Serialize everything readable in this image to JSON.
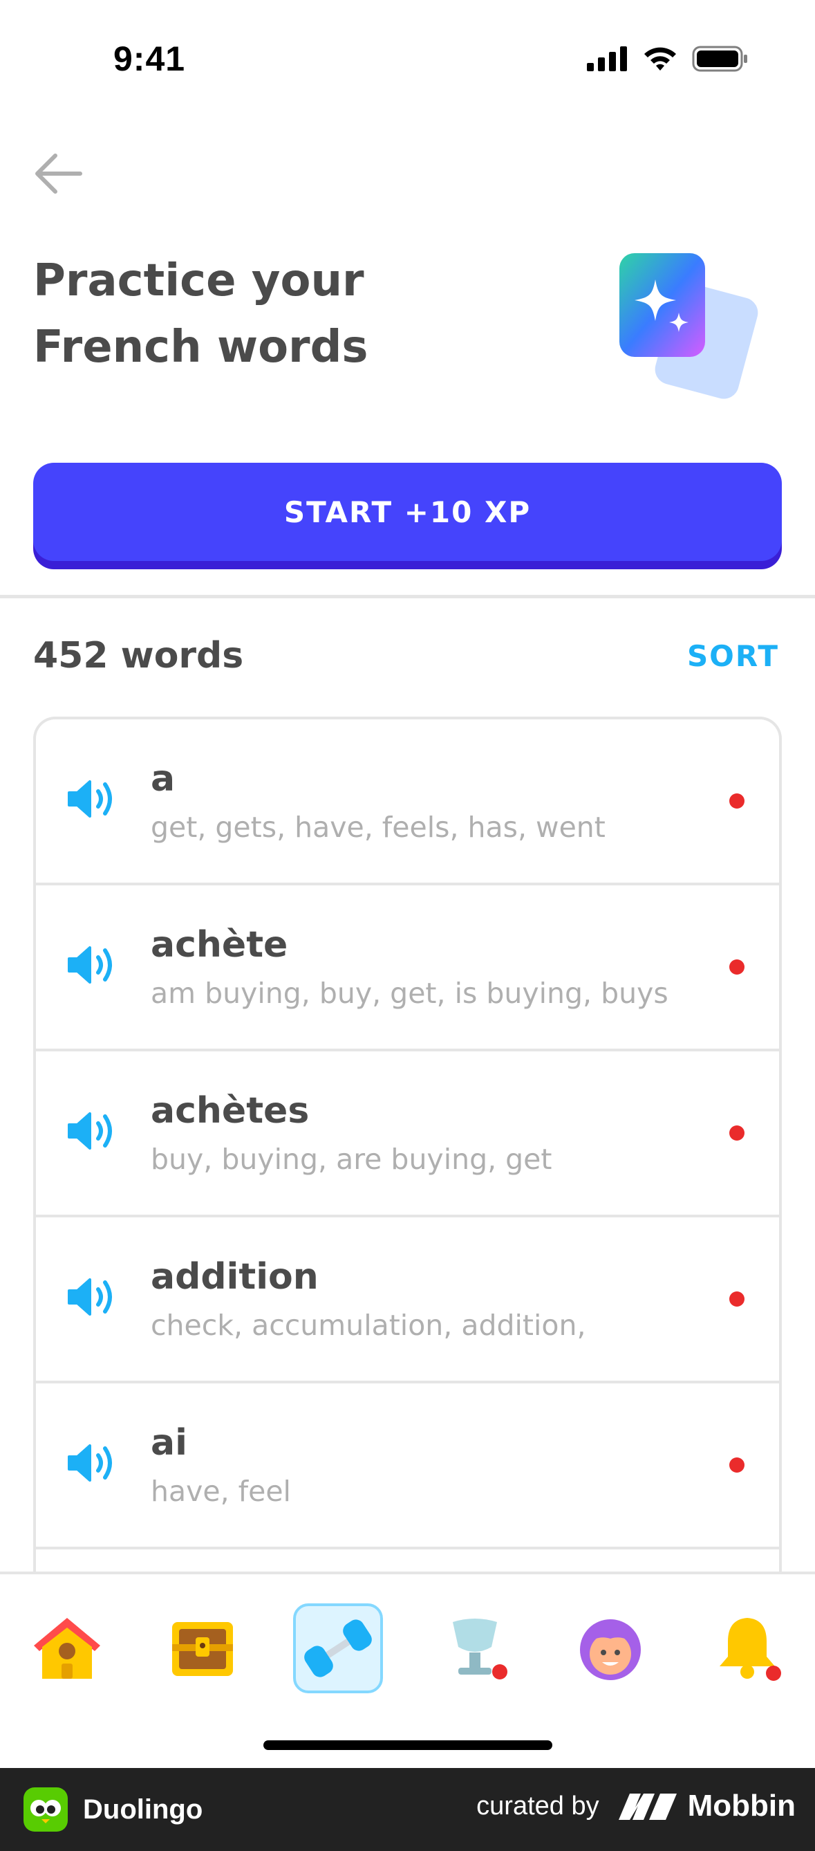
{
  "status_bar": {
    "time": "9:41"
  },
  "hero": {
    "title_line1": "Practice your",
    "title_line2": "French words"
  },
  "start_button": {
    "label": "START +10 XP"
  },
  "words": {
    "count_label": "452 words",
    "sort_label": "SORT",
    "items": [
      {
        "word": "a",
        "translations": "get, gets, have, feels, has, went"
      },
      {
        "word": "achète",
        "translations": "am buying, buy, get, is buying, buys"
      },
      {
        "word": "achètes",
        "translations": "buy, buying, are buying, get"
      },
      {
        "word": "addition",
        "translations": "check, accumulation, addition,"
      },
      {
        "word": "ai",
        "translations": "have, feel"
      }
    ]
  },
  "bottom_nav": {
    "items": [
      {
        "name": "home",
        "icon": "house-icon"
      },
      {
        "name": "chest",
        "icon": "treasure-chest-icon"
      },
      {
        "name": "practice",
        "icon": "dumbbell-icon",
        "active": true
      },
      {
        "name": "leagues",
        "icon": "trophy-cup-icon",
        "badge": true
      },
      {
        "name": "profile",
        "icon": "avatar-icon"
      },
      {
        "name": "notifications",
        "icon": "bell-icon",
        "badge": true
      }
    ]
  },
  "footer": {
    "app_name": "Duolingo",
    "curated_by": "curated by",
    "brand": "Mobbin"
  },
  "colors": {
    "primary_button": "#4544fc",
    "accent_blue": "#1cb0f6",
    "dot_red": "#ea2b2b",
    "text_dark": "#4b4b4b",
    "text_light": "#afafaf"
  }
}
